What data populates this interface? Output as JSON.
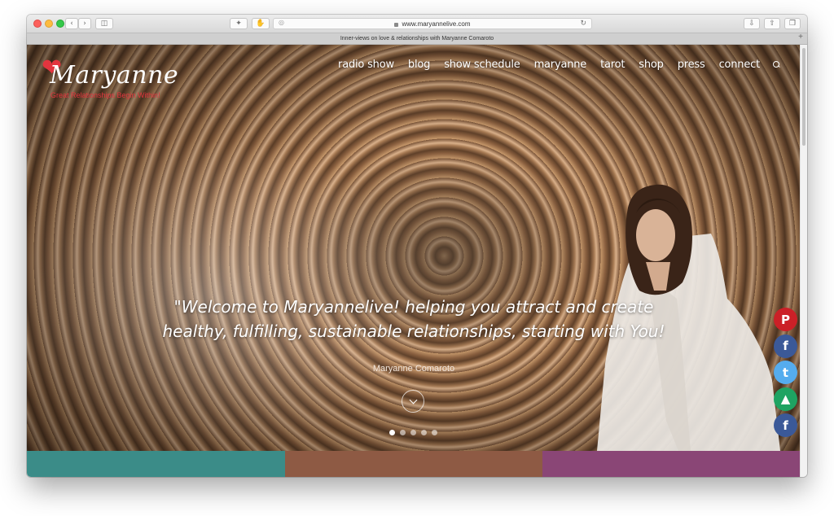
{
  "browser": {
    "url": "www.maryannelive.com",
    "tab_title": "Inner-views on love & relationships with Maryanne Comaroto"
  },
  "site": {
    "logo_text": "Maryanne",
    "tagline": "Great Relationships Begin Within!"
  },
  "nav": {
    "items": [
      "radio show",
      "blog",
      "show schedule",
      "maryanne",
      "tarot",
      "shop",
      "press",
      "connect"
    ]
  },
  "hero": {
    "quote_line1": "\"Welcome to Maryannelive! helping you attract and create",
    "quote_line2": "healthy, fulfilling, sustainable relationships, starting with You!",
    "attribution": "Maryanne Comaroto",
    "slides": 5,
    "active_slide": 1
  },
  "share": [
    {
      "name": "pinterest",
      "glyph": "P",
      "color": "#cb2027"
    },
    {
      "name": "facebook",
      "glyph": "f",
      "color": "#3b5998"
    },
    {
      "name": "twitter",
      "glyph": "t",
      "color": "#55acee"
    },
    {
      "name": "google-drive",
      "glyph": "▲",
      "color": "#1ea362"
    },
    {
      "name": "facebook-messenger",
      "glyph": "f",
      "color": "#3b5998"
    }
  ],
  "color_bars": [
    "#3b8c88",
    "#8e5a44",
    "#8a4676"
  ]
}
